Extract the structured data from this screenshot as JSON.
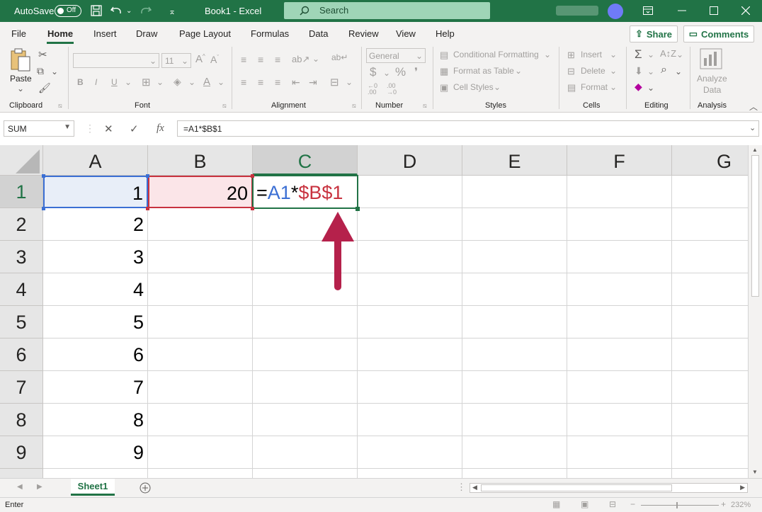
{
  "titlebar": {
    "autosave_label": "AutoSave",
    "autosave_state": "Off",
    "title": "Book1  -  Excel",
    "search_label": "Search"
  },
  "menu": {
    "tabs": [
      "File",
      "Home",
      "Insert",
      "Draw",
      "Page Layout",
      "Formulas",
      "Data",
      "Review",
      "View",
      "Help"
    ],
    "share": "Share",
    "comments": "Comments"
  },
  "ribbon": {
    "clipboard": {
      "label": "Clipboard",
      "paste": "Paste"
    },
    "font": {
      "label": "Font",
      "size": "11",
      "bold": "B",
      "italic": "I",
      "underline": "U"
    },
    "alignment": {
      "label": "Alignment"
    },
    "number": {
      "label": "Number",
      "format": "General",
      "currency": "$",
      "percent": "%"
    },
    "styles": {
      "label": "Styles",
      "conditional": "Conditional Formatting",
      "format_table": "Format as Table",
      "cell_styles": "Cell Styles"
    },
    "cells": {
      "label": "Cells",
      "insert": "Insert",
      "delete": "Delete",
      "format": "Format"
    },
    "editing": {
      "label": "Editing"
    },
    "analysis": {
      "label": "Analysis",
      "analyze": "Analyze",
      "data": "Data"
    }
  },
  "formula_bar": {
    "name_box": "SUM",
    "fx": "fx",
    "formula": "=A1*$B$1"
  },
  "grid": {
    "columns": [
      "A",
      "B",
      "C",
      "D",
      "E",
      "F",
      "G"
    ],
    "rows": [
      "1",
      "2",
      "3",
      "4",
      "5",
      "6",
      "7",
      "8",
      "9"
    ],
    "a_values": [
      "1",
      "2",
      "3",
      "4",
      "5",
      "6",
      "7",
      "8",
      "9"
    ],
    "b1": "20",
    "c1_parts": {
      "eq": "=",
      "ref1": "A1",
      "op": "*",
      "ref2": "$B$1"
    }
  },
  "sheets": {
    "active": "Sheet1"
  },
  "status": {
    "mode": "Enter",
    "zoom": "232%"
  },
  "colors": {
    "excel_green": "#217346",
    "ref_blue": "#3b6fd4",
    "ref_red": "#c8323f",
    "arrow": "#b5214b"
  }
}
